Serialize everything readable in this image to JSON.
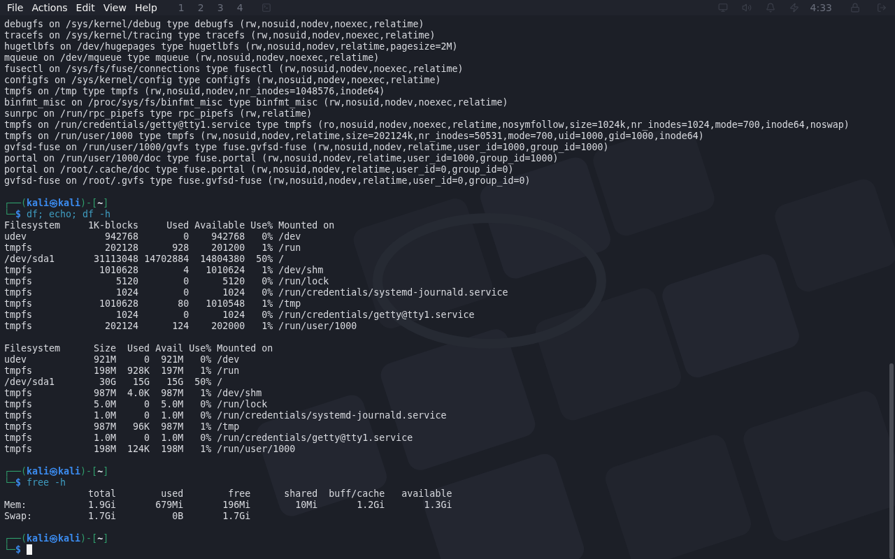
{
  "menu_bar": {
    "items": [
      "File",
      "Actions",
      "Edit",
      "View",
      "Help"
    ]
  },
  "background_panel": {
    "workspaces": [
      "1",
      "2",
      "3",
      "4"
    ],
    "clock": "4:33"
  },
  "terminal": {
    "blocks": [
      {
        "kind": "output",
        "lines": [
          "debugfs on /sys/kernel/debug type debugfs (rw,nosuid,nodev,noexec,relatime)",
          "tracefs on /sys/kernel/tracing type tracefs (rw,nosuid,nodev,noexec,relatime)",
          "hugetlbfs on /dev/hugepages type hugetlbfs (rw,nosuid,nodev,relatime,pagesize=2M)",
          "mqueue on /dev/mqueue type mqueue (rw,nosuid,nodev,noexec,relatime)",
          "fusectl on /sys/fs/fuse/connections type fusectl (rw,nosuid,nodev,noexec,relatime)",
          "configfs on /sys/kernel/config type configfs (rw,nosuid,nodev,noexec,relatime)",
          "tmpfs on /tmp type tmpfs (rw,nosuid,nodev,nr_inodes=1048576,inode64)",
          "binfmt_misc on /proc/sys/fs/binfmt_misc type binfmt_misc (rw,nosuid,nodev,noexec,relatime)",
          "sunrpc on /run/rpc_pipefs type rpc_pipefs (rw,relatime)",
          "tmpfs on /run/credentials/getty@tty1.service type tmpfs (ro,nosuid,nodev,noexec,relatime,nosymfollow,size=1024k,nr_inodes=1024,mode=700,inode64,noswap)",
          "tmpfs on /run/user/1000 type tmpfs (rw,nosuid,nodev,relatime,size=202124k,nr_inodes=50531,mode=700,uid=1000,gid=1000,inode64)",
          "gvfsd-fuse on /run/user/1000/gvfs type fuse.gvfsd-fuse (rw,nosuid,nodev,relatime,user_id=1000,group_id=1000)",
          "portal on /run/user/1000/doc type fuse.portal (rw,nosuid,nodev,relatime,user_id=1000,group_id=1000)",
          "portal on /root/.cache/doc type fuse.portal (rw,nosuid,nodev,relatime,user_id=0,group_id=0)",
          "gvfsd-fuse on /root/.gvfs type fuse.gvfsd-fuse (rw,nosuid,nodev,relatime,user_id=0,group_id=0)"
        ]
      },
      {
        "kind": "blank"
      },
      {
        "kind": "prompt",
        "frame_open": "┌──(",
        "user": "kali",
        "separator": "㉿",
        "host": "kali",
        "frame_mid": ")-[",
        "dir": "~",
        "frame_close": "]",
        "corner": "└─",
        "symbol": "$",
        "command": "df; echo; df -h"
      },
      {
        "kind": "df-table",
        "columns": [
          "Filesystem",
          "1K-blocks",
          "Used",
          "Available",
          "Use%",
          "Mounted on"
        ],
        "rows": [
          [
            "udev",
            "942768",
            "0",
            "942768",
            "0%",
            "/dev"
          ],
          [
            "tmpfs",
            "202128",
            "928",
            "201200",
            "1%",
            "/run"
          ],
          [
            "/dev/sda1",
            "31113048",
            "14702884",
            "14804380",
            "50%",
            "/"
          ],
          [
            "tmpfs",
            "1010628",
            "4",
            "1010624",
            "1%",
            "/dev/shm"
          ],
          [
            "tmpfs",
            "5120",
            "0",
            "5120",
            "0%",
            "/run/lock"
          ],
          [
            "tmpfs",
            "1024",
            "0",
            "1024",
            "0%",
            "/run/credentials/systemd-journald.service"
          ],
          [
            "tmpfs",
            "1010628",
            "80",
            "1010548",
            "1%",
            "/tmp"
          ],
          [
            "tmpfs",
            "1024",
            "0",
            "1024",
            "0%",
            "/run/credentials/getty@tty1.service"
          ],
          [
            "tmpfs",
            "202124",
            "124",
            "202000",
            "1%",
            "/run/user/1000"
          ]
        ]
      },
      {
        "kind": "blank"
      },
      {
        "kind": "dfh-table",
        "columns": [
          "Filesystem",
          "Size",
          "Used",
          "Avail",
          "Use%",
          "Mounted on"
        ],
        "rows": [
          [
            "udev",
            "921M",
            "0",
            "921M",
            "0%",
            "/dev"
          ],
          [
            "tmpfs",
            "198M",
            "928K",
            "197M",
            "1%",
            "/run"
          ],
          [
            "/dev/sda1",
            "30G",
            "15G",
            "15G",
            "50%",
            "/"
          ],
          [
            "tmpfs",
            "987M",
            "4.0K",
            "987M",
            "1%",
            "/dev/shm"
          ],
          [
            "tmpfs",
            "5.0M",
            "0",
            "5.0M",
            "0%",
            "/run/lock"
          ],
          [
            "tmpfs",
            "1.0M",
            "0",
            "1.0M",
            "0%",
            "/run/credentials/systemd-journald.service"
          ],
          [
            "tmpfs",
            "987M",
            "96K",
            "987M",
            "1%",
            "/tmp"
          ],
          [
            "tmpfs",
            "1.0M",
            "0",
            "1.0M",
            "0%",
            "/run/credentials/getty@tty1.service"
          ],
          [
            "tmpfs",
            "198M",
            "124K",
            "198M",
            "1%",
            "/run/user/1000"
          ]
        ]
      },
      {
        "kind": "blank"
      },
      {
        "kind": "prompt",
        "frame_open": "┌──(",
        "user": "kali",
        "separator": "㉿",
        "host": "kali",
        "frame_mid": ")-[",
        "dir": "~",
        "frame_close": "]",
        "corner": "└─",
        "symbol": "$",
        "command": "free -h"
      },
      {
        "kind": "free-table",
        "columns": [
          "",
          "total",
          "used",
          "free",
          "shared",
          "buff/cache",
          "available"
        ],
        "rows": [
          [
            "Mem:",
            "1.9Gi",
            "679Mi",
            "196Mi",
            "10Mi",
            "1.2Gi",
            "1.3Gi"
          ],
          [
            "Swap:",
            "1.7Gi",
            "0B",
            "1.7Gi"
          ]
        ]
      },
      {
        "kind": "blank"
      },
      {
        "kind": "prompt",
        "frame_open": "┌──(",
        "user": "kali",
        "separator": "㉿",
        "host": "kali",
        "frame_mid": ")-[",
        "dir": "~",
        "frame_close": "]",
        "corner": "└─",
        "symbol": "$",
        "cursor": true
      }
    ]
  }
}
